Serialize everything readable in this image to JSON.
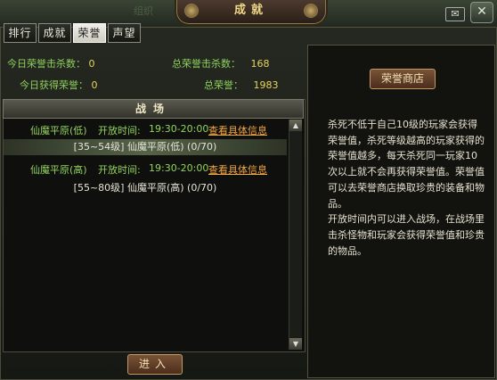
{
  "window": {
    "title": "成就",
    "close_label": "✕",
    "mail_icon": "✉",
    "corner_text": "组织"
  },
  "tabs": [
    {
      "label": "排行",
      "active": false
    },
    {
      "label": "成就",
      "active": false
    },
    {
      "label": "荣誉",
      "active": true
    },
    {
      "label": "声望",
      "active": false
    }
  ],
  "stats": {
    "today_kills_label": "今日荣誉击杀数：",
    "today_kills_value": "0",
    "total_kills_label": "总荣誉击杀数：",
    "total_kills_value": "168",
    "today_honor_label": "今日获得荣誉：",
    "today_honor_value": "0",
    "total_honor_label": "总荣誉：",
    "total_honor_value": "1983"
  },
  "battlefield": {
    "header": "战场",
    "entries": [
      {
        "name": "仙魔平原(低)",
        "time_label": "开放时间:",
        "time": "19:30-20:00",
        "link": "查看具体信息",
        "room": "[35~54级] 仙魔平原(低) (0/70)",
        "room_selected": true
      },
      {
        "name": "仙魔平原(高)",
        "time_label": "开放时间:",
        "time": "19:30-20:00",
        "link": "查看具体信息",
        "room": "[55~80级] 仙魔平原(高) (0/70)",
        "room_selected": false
      }
    ],
    "enter_label": "进入"
  },
  "right": {
    "shop_label": "荣誉商店",
    "desc1": "杀死不低于自己10级的玩家会获得荣誉值，杀死等级越高的玩家获得的荣誉值越多，每天杀死同一玩家10次以上就不会再获得荣誉值。荣誉值可以去荣誉商店换取珍贵的装备和物品。",
    "desc2": "开放时间内可以进入战场，在战场里击杀怪物和玩家会获得荣誉值和珍贵的物品。"
  },
  "colors": {
    "label_green": "#92d35e",
    "value_yellow": "#e8d45c",
    "link_orange": "#f1a640",
    "title_gold": "#f1d98a"
  }
}
